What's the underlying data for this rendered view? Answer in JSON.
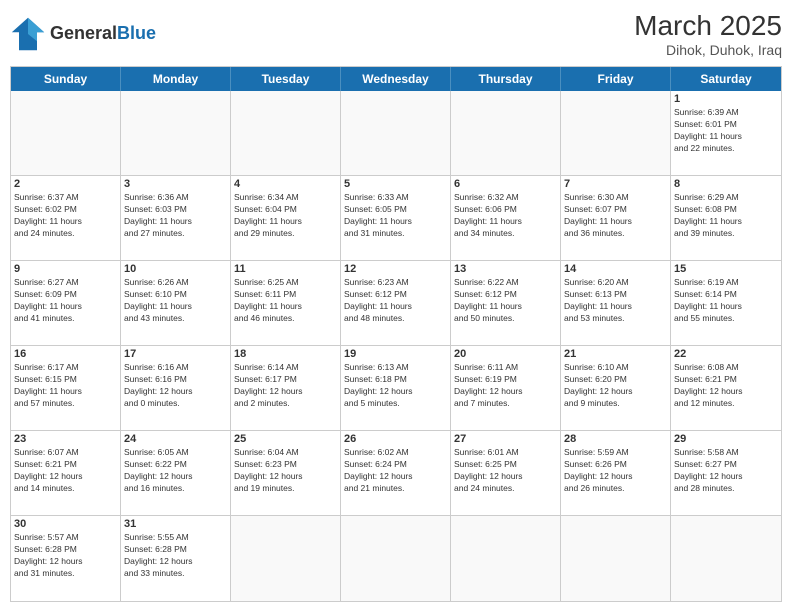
{
  "header": {
    "logo_general": "General",
    "logo_blue": "Blue",
    "month_title": "March 2025",
    "subtitle": "Dihok, Duhok, Iraq"
  },
  "day_headers": [
    "Sunday",
    "Monday",
    "Tuesday",
    "Wednesday",
    "Thursday",
    "Friday",
    "Saturday"
  ],
  "weeks": [
    [
      {
        "day": "",
        "info": ""
      },
      {
        "day": "",
        "info": ""
      },
      {
        "day": "",
        "info": ""
      },
      {
        "day": "",
        "info": ""
      },
      {
        "day": "",
        "info": ""
      },
      {
        "day": "",
        "info": ""
      },
      {
        "day": "1",
        "info": "Sunrise: 6:39 AM\nSunset: 6:01 PM\nDaylight: 11 hours\nand 22 minutes."
      }
    ],
    [
      {
        "day": "2",
        "info": "Sunrise: 6:37 AM\nSunset: 6:02 PM\nDaylight: 11 hours\nand 24 minutes."
      },
      {
        "day": "3",
        "info": "Sunrise: 6:36 AM\nSunset: 6:03 PM\nDaylight: 11 hours\nand 27 minutes."
      },
      {
        "day": "4",
        "info": "Sunrise: 6:34 AM\nSunset: 6:04 PM\nDaylight: 11 hours\nand 29 minutes."
      },
      {
        "day": "5",
        "info": "Sunrise: 6:33 AM\nSunset: 6:05 PM\nDaylight: 11 hours\nand 31 minutes."
      },
      {
        "day": "6",
        "info": "Sunrise: 6:32 AM\nSunset: 6:06 PM\nDaylight: 11 hours\nand 34 minutes."
      },
      {
        "day": "7",
        "info": "Sunrise: 6:30 AM\nSunset: 6:07 PM\nDaylight: 11 hours\nand 36 minutes."
      },
      {
        "day": "8",
        "info": "Sunrise: 6:29 AM\nSunset: 6:08 PM\nDaylight: 11 hours\nand 39 minutes."
      }
    ],
    [
      {
        "day": "9",
        "info": "Sunrise: 6:27 AM\nSunset: 6:09 PM\nDaylight: 11 hours\nand 41 minutes."
      },
      {
        "day": "10",
        "info": "Sunrise: 6:26 AM\nSunset: 6:10 PM\nDaylight: 11 hours\nand 43 minutes."
      },
      {
        "day": "11",
        "info": "Sunrise: 6:25 AM\nSunset: 6:11 PM\nDaylight: 11 hours\nand 46 minutes."
      },
      {
        "day": "12",
        "info": "Sunrise: 6:23 AM\nSunset: 6:12 PM\nDaylight: 11 hours\nand 48 minutes."
      },
      {
        "day": "13",
        "info": "Sunrise: 6:22 AM\nSunset: 6:12 PM\nDaylight: 11 hours\nand 50 minutes."
      },
      {
        "day": "14",
        "info": "Sunrise: 6:20 AM\nSunset: 6:13 PM\nDaylight: 11 hours\nand 53 minutes."
      },
      {
        "day": "15",
        "info": "Sunrise: 6:19 AM\nSunset: 6:14 PM\nDaylight: 11 hours\nand 55 minutes."
      }
    ],
    [
      {
        "day": "16",
        "info": "Sunrise: 6:17 AM\nSunset: 6:15 PM\nDaylight: 11 hours\nand 57 minutes."
      },
      {
        "day": "17",
        "info": "Sunrise: 6:16 AM\nSunset: 6:16 PM\nDaylight: 12 hours\nand 0 minutes."
      },
      {
        "day": "18",
        "info": "Sunrise: 6:14 AM\nSunset: 6:17 PM\nDaylight: 12 hours\nand 2 minutes."
      },
      {
        "day": "19",
        "info": "Sunrise: 6:13 AM\nSunset: 6:18 PM\nDaylight: 12 hours\nand 5 minutes."
      },
      {
        "day": "20",
        "info": "Sunrise: 6:11 AM\nSunset: 6:19 PM\nDaylight: 12 hours\nand 7 minutes."
      },
      {
        "day": "21",
        "info": "Sunrise: 6:10 AM\nSunset: 6:20 PM\nDaylight: 12 hours\nand 9 minutes."
      },
      {
        "day": "22",
        "info": "Sunrise: 6:08 AM\nSunset: 6:21 PM\nDaylight: 12 hours\nand 12 minutes."
      }
    ],
    [
      {
        "day": "23",
        "info": "Sunrise: 6:07 AM\nSunset: 6:21 PM\nDaylight: 12 hours\nand 14 minutes."
      },
      {
        "day": "24",
        "info": "Sunrise: 6:05 AM\nSunset: 6:22 PM\nDaylight: 12 hours\nand 16 minutes."
      },
      {
        "day": "25",
        "info": "Sunrise: 6:04 AM\nSunset: 6:23 PM\nDaylight: 12 hours\nand 19 minutes."
      },
      {
        "day": "26",
        "info": "Sunrise: 6:02 AM\nSunset: 6:24 PM\nDaylight: 12 hours\nand 21 minutes."
      },
      {
        "day": "27",
        "info": "Sunrise: 6:01 AM\nSunset: 6:25 PM\nDaylight: 12 hours\nand 24 minutes."
      },
      {
        "day": "28",
        "info": "Sunrise: 5:59 AM\nSunset: 6:26 PM\nDaylight: 12 hours\nand 26 minutes."
      },
      {
        "day": "29",
        "info": "Sunrise: 5:58 AM\nSunset: 6:27 PM\nDaylight: 12 hours\nand 28 minutes."
      }
    ],
    [
      {
        "day": "30",
        "info": "Sunrise: 5:57 AM\nSunset: 6:28 PM\nDaylight: 12 hours\nand 31 minutes."
      },
      {
        "day": "31",
        "info": "Sunrise: 5:55 AM\nSunset: 6:28 PM\nDaylight: 12 hours\nand 33 minutes."
      },
      {
        "day": "",
        "info": ""
      },
      {
        "day": "",
        "info": ""
      },
      {
        "day": "",
        "info": ""
      },
      {
        "day": "",
        "info": ""
      },
      {
        "day": "",
        "info": ""
      }
    ]
  ]
}
